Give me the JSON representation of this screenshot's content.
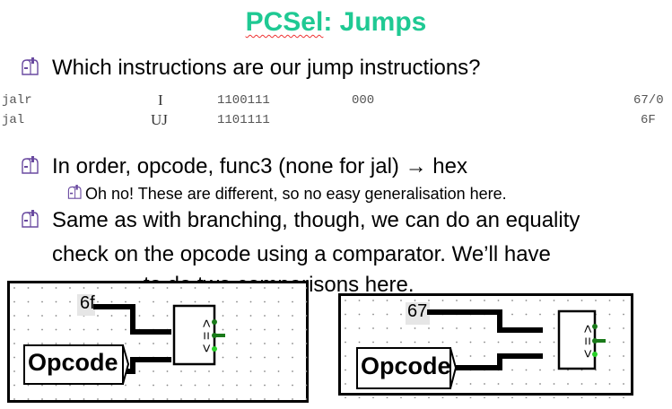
{
  "title": {
    "prefix": "PCSel",
    "rest": ": Jumps",
    "color": "#1fc993"
  },
  "bullets": [
    {
      "text": "Which instructions are our jump instructions?",
      "icon": "mailbox-bullet-icon"
    },
    {
      "text": "In order, opcode, func3 (none for jal) → hex",
      "icon": "mailbox-bullet-icon"
    },
    {
      "text": "Oh no! These are different, so no easy generalisation here.",
      "icon": "mailbox-bullet-icon",
      "level": 2
    },
    {
      "text": "Same as with branching, though, we can do an equality",
      "continuation": [
        "check on the opcode using a comparator.  We’ll have",
        "to do two comparisons here."
      ],
      "icon": "mailbox-bullet-icon"
    }
  ],
  "instr_table": {
    "rows": [
      {
        "name": "jalr",
        "format": "I",
        "opcode": "1100111",
        "funct3": "000",
        "hex": "67/0"
      },
      {
        "name": "jal",
        "format": "UJ",
        "opcode": "1101111",
        "funct3": "",
        "hex": "6F"
      }
    ]
  },
  "diagrams": [
    {
      "constant": "6f",
      "input_label": "Opcode",
      "comparator_outputs": [
        ">",
        "=",
        "<"
      ]
    },
    {
      "constant": "67",
      "input_label": "Opcode",
      "comparator_outputs": [
        ">",
        "=",
        "<"
      ]
    }
  ]
}
